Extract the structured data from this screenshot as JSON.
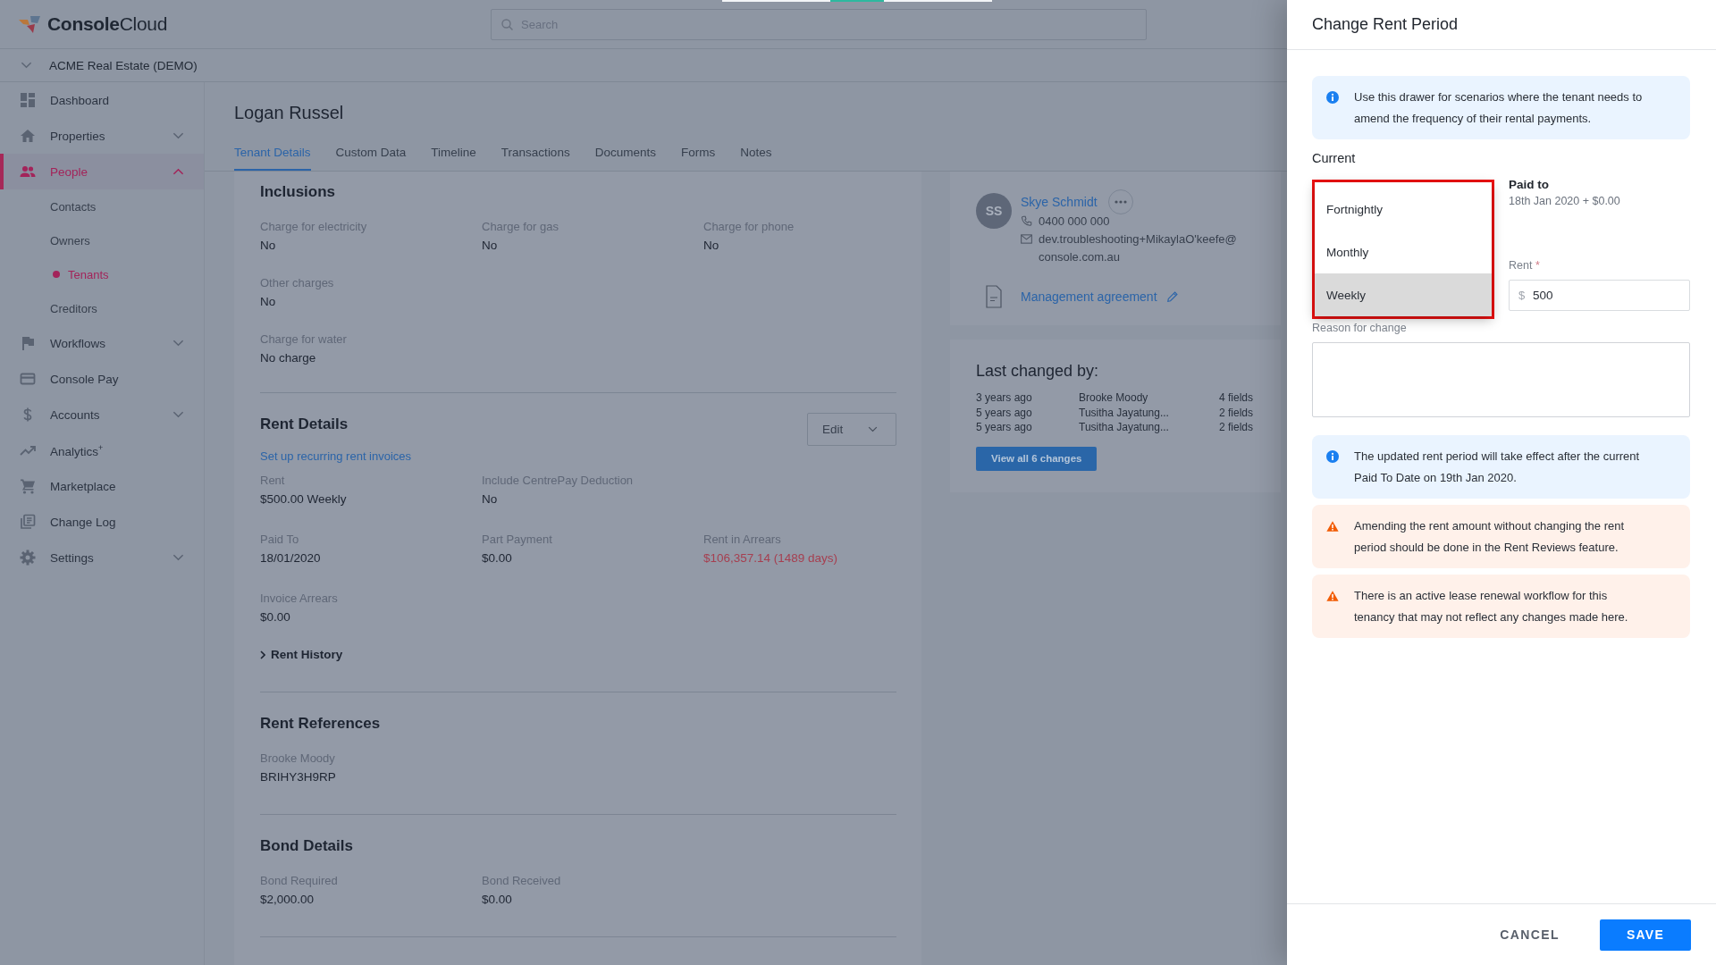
{
  "header": {
    "logo": "**Console**Cloud",
    "search": {
      "placeholder": "Search"
    }
  },
  "account": {
    "label": "ACME Real Estate (DEMO)",
    "expanded": false
  },
  "sidebar": {
    "items": [
      {
        "kind": "link",
        "label": "Dashboard",
        "selected": false
      },
      {
        "kind": "group",
        "label": "Properties",
        "selected": false,
        "expanded": false
      },
      {
        "kind": "group",
        "label": "People",
        "selected": true,
        "expanded": true,
        "children": [
          {
            "label": "Contacts",
            "selected": false
          },
          {
            "label": "Owners",
            "selected": false
          },
          {
            "label": "Tenants",
            "selected": true
          },
          {
            "label": "Creditors",
            "selected": false
          }
        ]
      },
      {
        "kind": "group",
        "label": "Workflows",
        "selected": false,
        "expanded": false
      },
      {
        "kind": "link",
        "label": "Console Pay",
        "selected": false
      },
      {
        "kind": "group",
        "label": "Accounts",
        "selected": false,
        "expanded": false
      },
      {
        "kind": "link",
        "label": "Analytics$^{+}$",
        "selected": false
      },
      {
        "kind": "link",
        "label": "Marketplace",
        "selected": false
      },
      {
        "kind": "link",
        "label": "Change Log",
        "selected": false
      },
      {
        "kind": "group",
        "label": "Settings",
        "selected": false,
        "expanded": false
      }
    ]
  },
  "page": {
    "title": "Logan Russel",
    "tabs": [
      {
        "label": "Tenant Details",
        "selected": true
      },
      {
        "label": "Custom Data",
        "selected": false
      },
      {
        "label": "Timeline",
        "selected": false
      },
      {
        "label": "Transactions",
        "selected": false
      },
      {
        "label": "Documents",
        "selected": false
      },
      {
        "label": "Forms",
        "selected": false
      },
      {
        "label": "Notes",
        "selected": false
      }
    ],
    "sections": [
      {
        "title": "Inclusions",
        "rows": [
          [
            {
              "label": "Charge for electricity",
              "value": "No",
              "alert": false
            },
            {
              "label": "Charge for gas",
              "value": "No",
              "alert": false
            },
            {
              "label": "Charge for phone",
              "value": "No",
              "alert": false
            }
          ],
          [
            {
              "label": "Other charges",
              "value": "No",
              "alert": false
            }
          ],
          [
            {
              "label": "Charge for water",
              "value": "No charge",
              "alert": false
            }
          ]
        ]
      },
      {
        "title": "Rent Details",
        "action": {
          "label": "Edit"
        },
        "link": "Set up recurring rent invoices",
        "rows": [
          [
            {
              "label": "Rent",
              "value": "$500.00 Weekly",
              "alert": false
            },
            {
              "label": "Include CentrePay Deduction",
              "value": "No",
              "alert": false
            }
          ],
          [
            {
              "label": "Paid To",
              "value": "18/01/2020",
              "alert": false
            },
            {
              "label": "Part Payment",
              "value": "$0.00",
              "alert": false
            },
            {
              "label": "Rent in Arrears",
              "value": "$106,357.14 (1489 days)",
              "alert": true
            }
          ],
          [
            {
              "label": "Invoice Arrears",
              "value": "$0.00",
              "alert": false
            }
          ]
        ],
        "expander": {
          "label": "Rent History",
          "expanded": false
        }
      },
      {
        "title": "Rent References",
        "rows": [
          [
            {
              "label": "Brooke Moody",
              "value": "BRIHY3H9RP",
              "alert": false
            }
          ]
        ]
      },
      {
        "title": "Bond Details",
        "rows": [
          [
            {
              "label": "Bond Required",
              "value": "$2,000.00",
              "alert": false
            },
            {
              "label": "Bond Received",
              "value": "$0.00",
              "alert": false
            }
          ]
        ]
      }
    ]
  },
  "owners": {
    "owner": {
      "initials": "SS",
      "name": "Skye Schmidt",
      "phone": "0400 000 000",
      "email": "dev.troubleshooting+MikaylaO'keefe@console.com.au"
    },
    "agreement": {
      "label": "Management agreement"
    }
  },
  "last_changed": {
    "title": "Last changed by:",
    "rows": [
      {
        "when": "3 years ago",
        "who": "Brooke Moody",
        "fields": "4 fields"
      },
      {
        "when": "5 years ago",
        "who": "Tusitha Jayatung...",
        "fields": "2 fields"
      },
      {
        "when": "5 years ago",
        "who": "Tusitha Jayatung...",
        "fields": "2 fields"
      }
    ],
    "button": "View all 6 changes"
  },
  "drawer": {
    "title": "Change Rent Period",
    "intro": {
      "kind": "info",
      "text": "Use this drawer for scenarios where the tenant needs to amend the frequency of their rental payments."
    },
    "current_label": "Current",
    "period_menu": {
      "highlighted": true,
      "options": [
        {
          "label": "Fortnightly",
          "selected": false
        },
        {
          "label": "Monthly",
          "selected": false
        },
        {
          "label": "Weekly",
          "selected": true
        }
      ]
    },
    "paid_to": {
      "label": "Paid to",
      "value": "18th Jan 2020 + $0.00"
    },
    "rent": {
      "label": "Rent",
      "required_mark": "*",
      "prefix": "$",
      "value": "500"
    },
    "reason": {
      "label": "Reason for change"
    },
    "notices": [
      {
        "kind": "info",
        "text": "The updated rent period will take effect after the current Paid To Date on 19th Jan 2020."
      },
      {
        "kind": "warning",
        "text": "Amending the rent amount without changing the rent period should be done in the Rent Reviews feature."
      },
      {
        "kind": "warning",
        "text": "There is an active lease renewal workflow for this tenancy that may not reflect any changes made here."
      }
    ],
    "cancel": "CANCEL",
    "save": "SAVE"
  }
}
